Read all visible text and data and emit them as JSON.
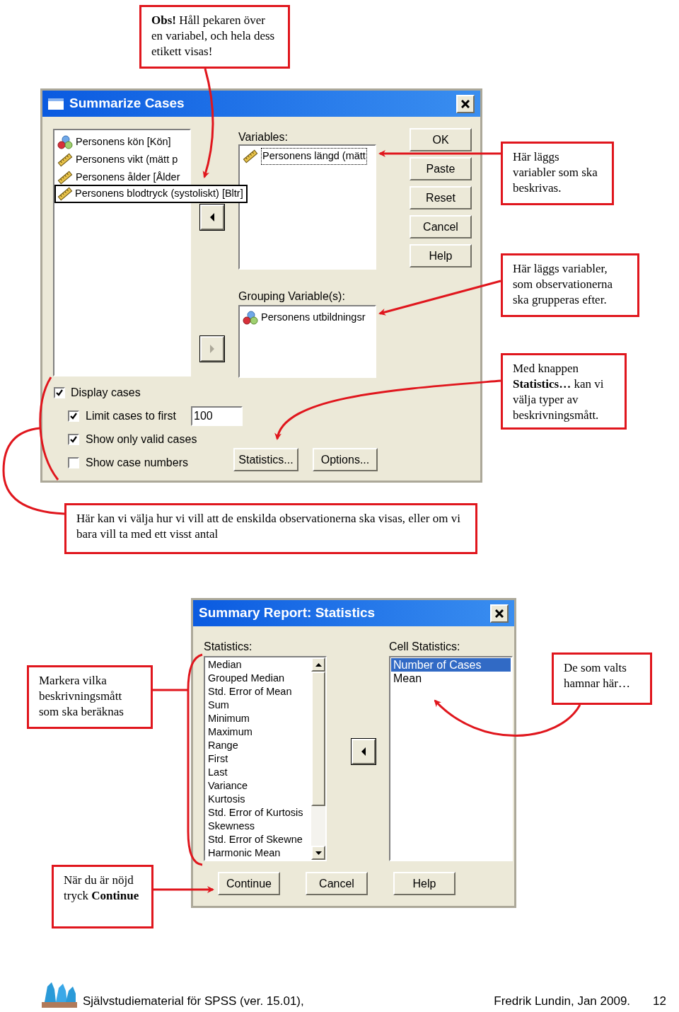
{
  "callouts": [
    {
      "text": "**Obs!** Håll pekaren över en variabel, och hela dess etikett visas!"
    },
    {
      "text": "Här läggs variabler som ska beskrivas."
    },
    {
      "text": "Här läggs variabler, som observationerna ska grupperas efter."
    },
    {
      "text": "Med knappen **Statistics…** kan vi välja typer av beskrivningsmått."
    },
    {
      "text": "Här kan vi välja hur vi vill att de enskilda observationerna ska visas, eller om vi bara vill ta med ett visst antal"
    },
    {
      "text": "Markera vilka beskrivningsmått som ska beräknas"
    },
    {
      "text": "De som valts hamnar här…"
    },
    {
      "text": "När du är nöjd tryck **Continue**"
    }
  ],
  "summarize_cases": {
    "title": "Summarize Cases",
    "source_list": [
      {
        "label": "Personens kön [Kön]",
        "kind": "nominal"
      },
      {
        "label": "Personens vikt (mätt p",
        "kind": "scale"
      },
      {
        "label": "Personens ålder [Ålder",
        "kind": "scale"
      }
    ],
    "tooltip": {
      "label": "Personens blodtryck (systoliskt) [Bltr]",
      "kind": "scale"
    },
    "variables_label": "Variables:",
    "variables": [
      {
        "label": "Personens längd (mätt",
        "kind": "scale"
      }
    ],
    "grouping_label": "Grouping Variable(s):",
    "grouping": [
      {
        "label": "Personens utbildningsr",
        "kind": "nominal"
      }
    ],
    "buttons": [
      "OK",
      "Paste",
      "Reset",
      "Cancel",
      "Help"
    ],
    "display_options": [
      {
        "label": "Display cases",
        "checked": true,
        "children": [
          {
            "label": "Limit cases to first",
            "checked": true,
            "value": "100"
          },
          {
            "label": "Show only valid cases",
            "checked": true
          },
          {
            "label": "Show case numbers",
            "checked": false
          }
        ]
      }
    ],
    "bottom_buttons": [
      "Statistics...",
      "Options..."
    ]
  },
  "statistics_dialog": {
    "title": "Summary Report: Statistics",
    "statistics_label": "Statistics:",
    "statistics": [
      "Median",
      "Grouped Median",
      "Std. Error of Mean",
      "Sum",
      "Minimum",
      "Maximum",
      "Range",
      "First",
      "Last",
      "Variance",
      "Kurtosis",
      "Std. Error of Kurtosis",
      "Skewness",
      "Std. Error of Skewne",
      "Harmonic Mean"
    ],
    "cell_label": "Cell Statistics:",
    "cell_statistics": [
      {
        "label": "Number of Cases",
        "selected": true
      },
      {
        "label": "Mean",
        "selected": false
      }
    ],
    "buttons": [
      "Continue",
      "Cancel",
      "Help"
    ]
  },
  "footer": {
    "left": "Självstudiematerial för SPSS (ver. 15.01),",
    "right": "Fredrik Lundin, Jan 2009.",
    "page": "12"
  }
}
